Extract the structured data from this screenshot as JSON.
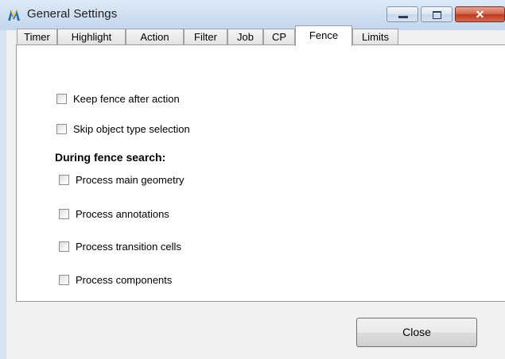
{
  "window": {
    "title": "General Settings",
    "app_icon": "microstation-logo-icon",
    "controls": [
      "minimize-icon",
      "maximize-icon",
      "close-icon"
    ]
  },
  "tabs": [
    {
      "label": "Timer"
    },
    {
      "label": "Highlight"
    },
    {
      "label": "Action"
    },
    {
      "label": "Filter"
    },
    {
      "label": "Job"
    },
    {
      "label": "CP"
    },
    {
      "label": "Fence",
      "active": true
    },
    {
      "label": "Limits"
    }
  ],
  "fence": {
    "keep_fence": {
      "label": "Keep fence after action",
      "checked": false
    },
    "skip_object": {
      "label": "Skip object type selection",
      "checked": false
    },
    "search_heading": "During fence search:",
    "search_options": [
      {
        "label": "Process main geometry",
        "checked": false
      },
      {
        "label": "Process annotations",
        "checked": false
      },
      {
        "label": "Process transition cells",
        "checked": false
      },
      {
        "label": "Process components",
        "checked": false
      }
    ]
  },
  "footer": {
    "close_label": "Close"
  },
  "colors": {
    "title_bar": "#cfdff1",
    "close_button": "#c8452a",
    "dialog_background": "#f0f0f0",
    "panel_background": "#ffffff"
  }
}
